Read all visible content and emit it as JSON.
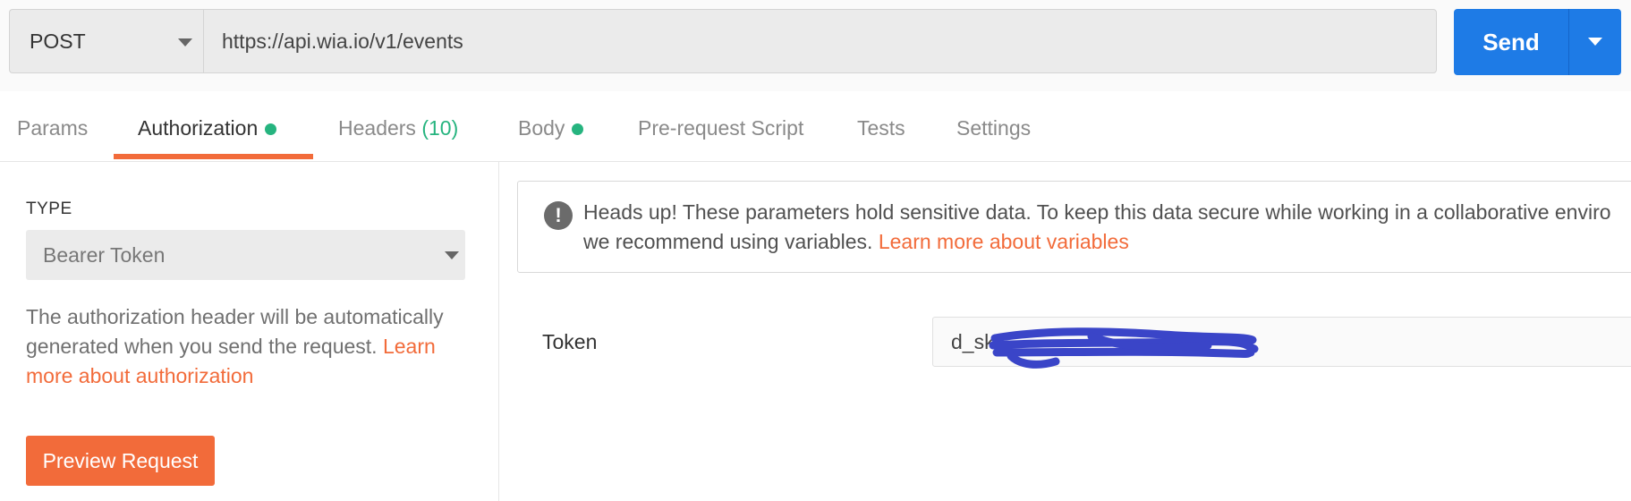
{
  "request": {
    "method": "POST",
    "url": "https://api.wia.io/v1/events",
    "send_label": "Send"
  },
  "tabs": [
    {
      "label": "Params"
    },
    {
      "label": "Authorization",
      "indicator": true,
      "active": true
    },
    {
      "label": "Headers",
      "count": "(10)"
    },
    {
      "label": "Body",
      "indicator": true
    },
    {
      "label": "Pre-request Script"
    },
    {
      "label": "Tests"
    },
    {
      "label": "Settings"
    }
  ],
  "auth": {
    "type_label": "TYPE",
    "type_value": "Bearer Token",
    "description": "The authorization header will be automatically generated when you send the request.",
    "description_link": "Learn more about authorization",
    "preview_button": "Preview Request"
  },
  "notice": {
    "text": "Heads up! These parameters hold sensitive data. To keep this data secure while working in a collaborative enviro",
    "text_line2": "we recommend using variables.",
    "link": "Learn more about variables"
  },
  "token": {
    "label": "Token",
    "value": "d_sk_"
  },
  "colors": {
    "accent_orange": "#f26b3a",
    "send_blue": "#1e7be6",
    "indicator_green": "#26b47f",
    "redaction_blue": "#3a45c8"
  },
  "icons": {
    "method_dropdown": "chevron-down-icon",
    "send_dropdown": "chevron-down-icon",
    "type_dropdown": "chevron-down-icon",
    "notice": "exclamation-circle-icon"
  }
}
